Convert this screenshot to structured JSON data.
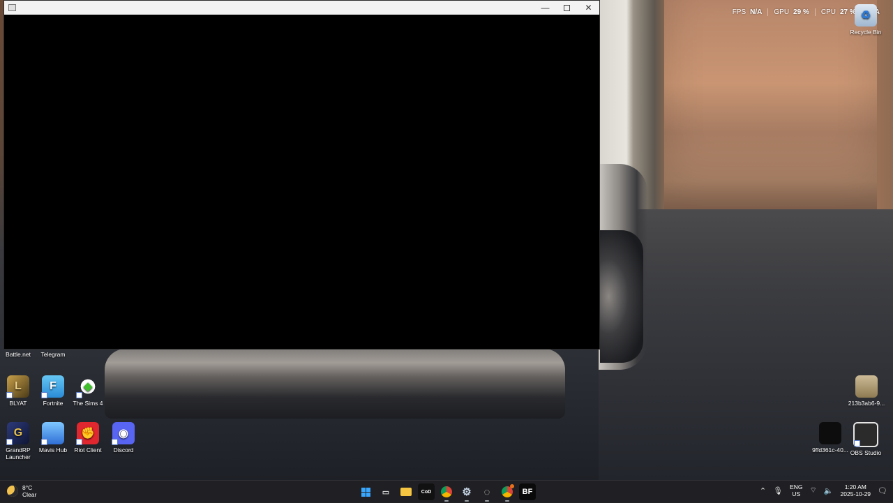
{
  "window": {
    "controls": {
      "minimize": "—",
      "maximize": "",
      "close": "✕"
    }
  },
  "overlay": {
    "stats": [
      {
        "label": "FPS",
        "value": "N/A"
      },
      {
        "label": "GPU",
        "value": "29 %"
      },
      {
        "label": "CPU",
        "value": "27 %"
      },
      {
        "label": "",
        "value": "N/A"
      }
    ]
  },
  "desktop": {
    "icons": [
      {
        "label": "Recycle Bin",
        "glyph": "♻",
        "icon": "recycle-bin-icon"
      },
      {
        "label": "Battle.net",
        "glyph": "",
        "icon": "battlenet-icon"
      },
      {
        "label": "Telegram",
        "glyph": "",
        "icon": "telegram-icon"
      },
      {
        "label": "BLYAT",
        "glyph": "L",
        "icon": "league-icon"
      },
      {
        "label": "Fortnite",
        "glyph": "F",
        "icon": "fortnite-icon"
      },
      {
        "label": "The Sims 4",
        "glyph": "◆",
        "icon": "sims-icon"
      },
      {
        "label": "GrandRP Launcher",
        "glyph": "G",
        "icon": "grandrp-icon"
      },
      {
        "label": "Mavis Hub",
        "glyph": "",
        "icon": "mavis-hub-icon"
      },
      {
        "label": "Riot Client",
        "glyph": "✊",
        "icon": "riot-client-icon"
      },
      {
        "label": "Discord",
        "glyph": "◉",
        "icon": "discord-icon"
      },
      {
        "label": "213b3ab6-9...",
        "glyph": "",
        "icon": "image-file-icon"
      },
      {
        "label": "9ffd361c-40...",
        "glyph": "",
        "icon": "image-file-icon"
      },
      {
        "label": "OBS Studio",
        "glyph": "",
        "icon": "obs-icon"
      }
    ]
  },
  "taskbar": {
    "weather": {
      "temp": "8°C",
      "condition": "Clear"
    },
    "apps": [
      {
        "name": "start",
        "label": ""
      },
      {
        "name": "task-view",
        "label": "▭"
      },
      {
        "name": "file-explorer",
        "label": ""
      },
      {
        "name": "call-of-duty",
        "label": "CoD"
      },
      {
        "name": "chrome",
        "label": ""
      },
      {
        "name": "settings",
        "label": "⚙"
      },
      {
        "name": "steam-alt",
        "label": "◌"
      },
      {
        "name": "chrome-badge",
        "label": ""
      },
      {
        "name": "battlefield",
        "label": "BF"
      }
    ],
    "tray": {
      "language": "ENG",
      "region": "US",
      "time": "1:20 AM",
      "date": "2025-10-29"
    }
  },
  "colors": {
    "accent": "#3aa7ff",
    "taskbar_bg": "#202024",
    "titlebar_bg": "#f3f3f3"
  }
}
